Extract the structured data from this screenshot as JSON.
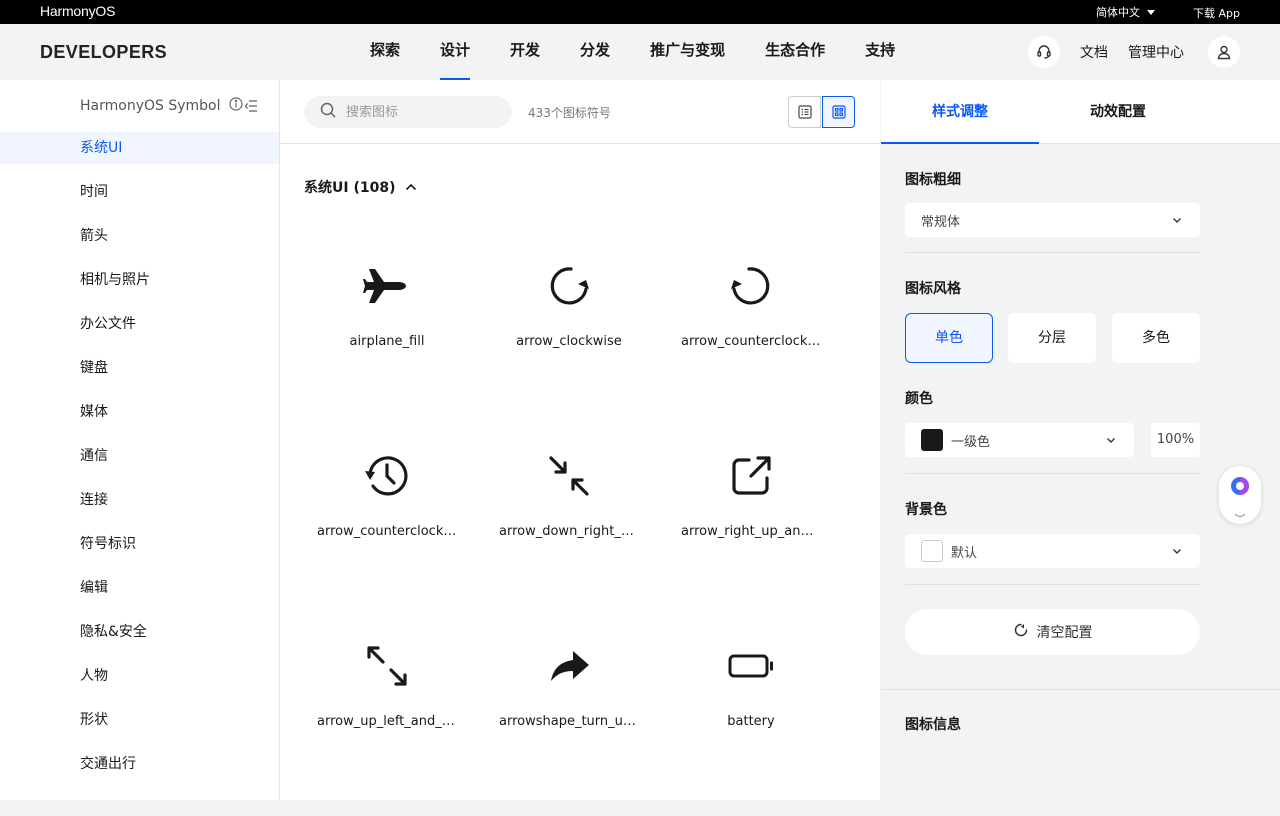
{
  "topbar": {
    "brand": "HarmonyOS",
    "lang": "简体中文",
    "download": "下载 App"
  },
  "header": {
    "logo": "DEVELOPERS",
    "nav": [
      "探索",
      "设计",
      "开发",
      "分发",
      "推广与变现",
      "生态合作",
      "支持"
    ],
    "active_nav": "设计",
    "doc": "文档",
    "mgmt": "管理中心"
  },
  "sidebar": {
    "title": "HarmonyOS Symbol",
    "categories": [
      "系统UI",
      "时间",
      "箭头",
      "相机与照片",
      "办公文件",
      "键盘",
      "媒体",
      "通信",
      "连接",
      "符号标识",
      "编辑",
      "隐私&安全",
      "人物",
      "形状",
      "交通出行"
    ],
    "active": "系统UI"
  },
  "main": {
    "search_placeholder": "搜索图标",
    "count": "433个图标符号",
    "section_title": "系统UI (108)",
    "icons": [
      {
        "name": "airplane_fill",
        "icon": "airplane-icon"
      },
      {
        "name": "arrow_clockwise",
        "icon": "arrow-clockwise-icon"
      },
      {
        "name": "arrow_counterclockwise",
        "icon": "arrow-counterclockwise-icon"
      },
      {
        "name": "arrow_counterclockwise_clock",
        "icon": "arrow-counterclockwise-clock-icon"
      },
      {
        "name": "arrow_down_right_and_arrow_up_left",
        "icon": "arrow-down-right-and-up-left-icon"
      },
      {
        "name": "arrow_right_up_and_square",
        "icon": "arrow-right-up-square-icon"
      },
      {
        "name": "arrow_up_left_and_arrow_down_right",
        "icon": "arrow-up-left-and-down-right-icon"
      },
      {
        "name": "arrowshape_turn_up_right_fill",
        "icon": "arrowshape-turn-icon"
      },
      {
        "name": "battery",
        "icon": "battery-icon"
      }
    ]
  },
  "panel": {
    "tabs": [
      "样式调整",
      "动效配置"
    ],
    "active_tab": "样式调整",
    "weight_label": "图标粗细",
    "weight_value": "常规体",
    "style_label": "图标风格",
    "styles": [
      "单色",
      "分层",
      "多色"
    ],
    "active_style": "单色",
    "color_label": "颜色",
    "color_value": "一级色",
    "color_swatch": "#191919",
    "opacity": "100%",
    "bg_label": "背景色",
    "bg_value": "默认",
    "clear": "清空配置",
    "info_label": "图标信息"
  },
  "colors": {
    "accent": "#0a59f7",
    "text": "#191919",
    "panel_bg": "#f1f3f5"
  }
}
